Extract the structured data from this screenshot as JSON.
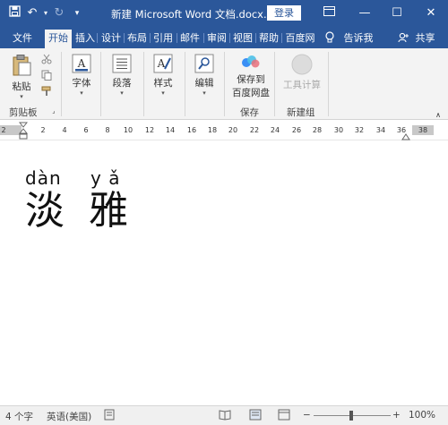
{
  "titlebar": {
    "doc_title": "新建 Microsoft Word 文档.docx...",
    "login": "登录",
    "save_icon": "save-icon",
    "undo_icon": "undo-icon",
    "redo_icon": "redo-icon",
    "qat_menu_icon": "customize-icon"
  },
  "window": {
    "minimize": "—",
    "maximize": "☐",
    "close": "✕",
    "restore": "▣"
  },
  "tabs": [
    {
      "label": "文件"
    },
    {
      "label": "开始"
    },
    {
      "label": "插入"
    },
    {
      "label": "设计"
    },
    {
      "label": "布局"
    },
    {
      "label": "引用"
    },
    {
      "label": "邮件"
    },
    {
      "label": "审阅"
    },
    {
      "label": "视图"
    },
    {
      "label": "帮助"
    },
    {
      "label": "百度网"
    }
  ],
  "tell_me": "告诉我",
  "share": "共享",
  "ribbon": {
    "paste": "粘贴",
    "clipboard": "剪贴板",
    "font": "字体",
    "paragraph": "段落",
    "styles": "样式",
    "editing": "编辑",
    "save_to_line1": "保存到",
    "save_to_line2": "百度网盘",
    "save_group": "保存",
    "tool_calc": "工具计算",
    "new_group": "新建组"
  },
  "ruler": {
    "marks": [
      "2",
      "2",
      "4",
      "6",
      "8",
      "10",
      "12",
      "14",
      "16",
      "18",
      "20",
      "22",
      "24",
      "26",
      "28",
      "30",
      "32",
      "34",
      "36",
      "38"
    ]
  },
  "document": {
    "pinyin": [
      "dàn",
      "y ǎ"
    ],
    "chars": [
      "淡",
      "雅"
    ]
  },
  "status": {
    "word_count": "4 个字",
    "language": "英语(美国)",
    "zoom": "100%",
    "zoom_minus": "−",
    "zoom_plus": "+"
  },
  "colors": {
    "accent": "#2b579a",
    "ribbon_bg": "#f3f3f3",
    "status_bg": "#f0f0f0"
  }
}
